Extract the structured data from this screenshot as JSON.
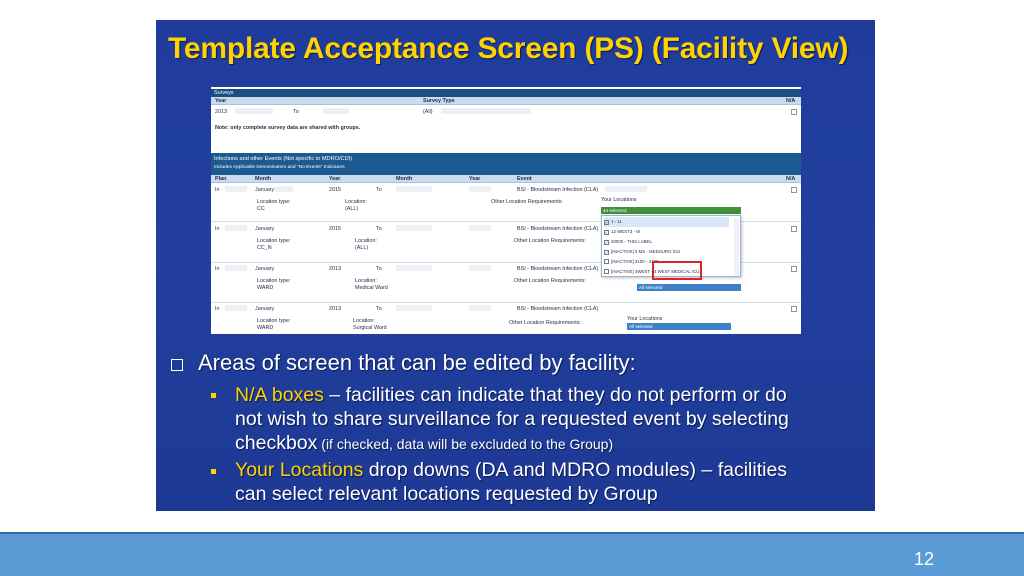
{
  "slide": {
    "title": "Template Acceptance Screen (PS) (Facility View)",
    "page_number": "12"
  },
  "screenshot": {
    "surveys": {
      "section_label": "Surveys",
      "col_year": "Year",
      "col_survey_type": "Survey Type",
      "col_na": "N/A",
      "year_value": "2013",
      "to_label": "To",
      "survey_type_value": "(All)",
      "note": "Note: only complete survey data are shared with groups."
    },
    "infections": {
      "section_label": "Infections and other Events (Not specific to MDRO/CDI)",
      "section_sublabel": "Includes Applicable Denominators and \"No Events\" Indicators",
      "headers": [
        "Plan",
        "Month",
        "Year",
        "Month",
        "Year",
        "Event",
        "N/A"
      ],
      "rows": [
        {
          "plan": "In",
          "month": "January",
          "year": "2015",
          "to": "To",
          "event": "BSI - Bloodstream Infection (CLA)",
          "loc_type_label": "Location type:",
          "loc_type": "CC",
          "loc_label": "Location:",
          "loc": "(ALL)",
          "other_label": "Other Location Requirements:",
          "your_loc_label": "Your Locations",
          "your_loc_value": "44 selected"
        },
        {
          "plan": "In",
          "month": "January",
          "year": "2015",
          "to": "To",
          "event": "BSI - Bloodstream Infection (CLA)",
          "loc_type_label": "Location type:",
          "loc_type": "CC_N",
          "loc_label": "Location:",
          "loc": "(ALL)",
          "other_label": "Other Location Requirements:",
          "your_loc_label": "",
          "your_loc_value": ""
        },
        {
          "plan": "In",
          "month": "January",
          "year": "2013",
          "to": "To",
          "event": "BSI - Bloodstream Infection (CLA)",
          "loc_type_label": "Location type:",
          "loc_type": "WARD",
          "loc_label": "Location:",
          "loc": "Medical Ward",
          "other_label": "Other Location Requirements:",
          "your_loc_label": "",
          "your_loc_value": "All selected"
        },
        {
          "plan": "In",
          "month": "January",
          "year": "2013",
          "to": "To",
          "event": "BSI - Bloodstream Infection (CLA)",
          "loc_type_label": "Location type:",
          "loc_type": "WARD",
          "loc_label": "Location:",
          "loc": "Surgical Ward",
          "other_label": "Other Location Requirements:",
          "your_loc_label": "Your Locations",
          "your_loc_value": "All selected"
        }
      ],
      "dropdown_options": [
        {
          "label": "1 - 11",
          "checked": true
        },
        {
          "label": "12 WEST3 - W",
          "checked": true
        },
        {
          "label": "20000 - THIS LABEL",
          "checked": true
        },
        {
          "label": "[INACTIVE] 3 MS - MEDSURG ICU",
          "checked": true
        },
        {
          "label": "[INACTIVE] 3100 - 3100",
          "checked": false
        },
        {
          "label": "[INACTIVE] 4WEST - 4 WEST MEDICAL ICU",
          "checked": false
        }
      ]
    }
  },
  "bullets": {
    "main": "Areas of screen that can be edited by facility:",
    "item1_highlight": "N/A boxes",
    "item1_line1": " – facilities can indicate that they do not perform or do",
    "item1_line2": "not wish to share surveillance for a requested event by selecting",
    "item1_line3": "checkbox",
    "item1_small": " (if checked, data will be excluded to the Group)",
    "item2_highlight": "Your Locations",
    "item2_line1": " drop downs (DA and MDRO modules) – facilities",
    "item2_line2": "can select relevant locations requested by Group"
  },
  "colors": {
    "panel_blue": "#1f3c9c",
    "title_yellow": "#ffd200",
    "highlight_red": "#e0202a",
    "footer_blue": "#5b9bd5"
  }
}
